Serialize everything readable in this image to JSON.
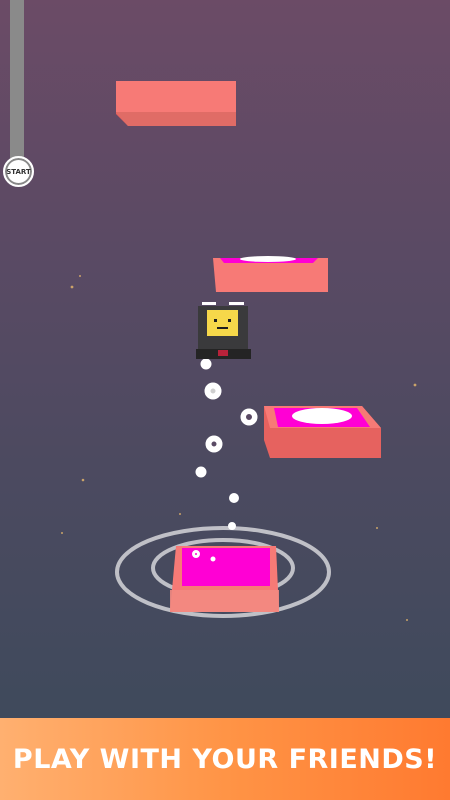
{
  "hud": {
    "start_label": "START"
  },
  "banner": {
    "text": "PLAY WITH YOUR FRIENDS!"
  },
  "colors": {
    "tile_top": "#f77a76",
    "tile_side": "#e6625f",
    "tile_center": "#ff00d4",
    "character_face": "#f6d84a",
    "banner_start": "#ffb070",
    "banner_end": "#ff7a30"
  },
  "icons": [
    "player-cube-icon",
    "start-marker-icon"
  ]
}
